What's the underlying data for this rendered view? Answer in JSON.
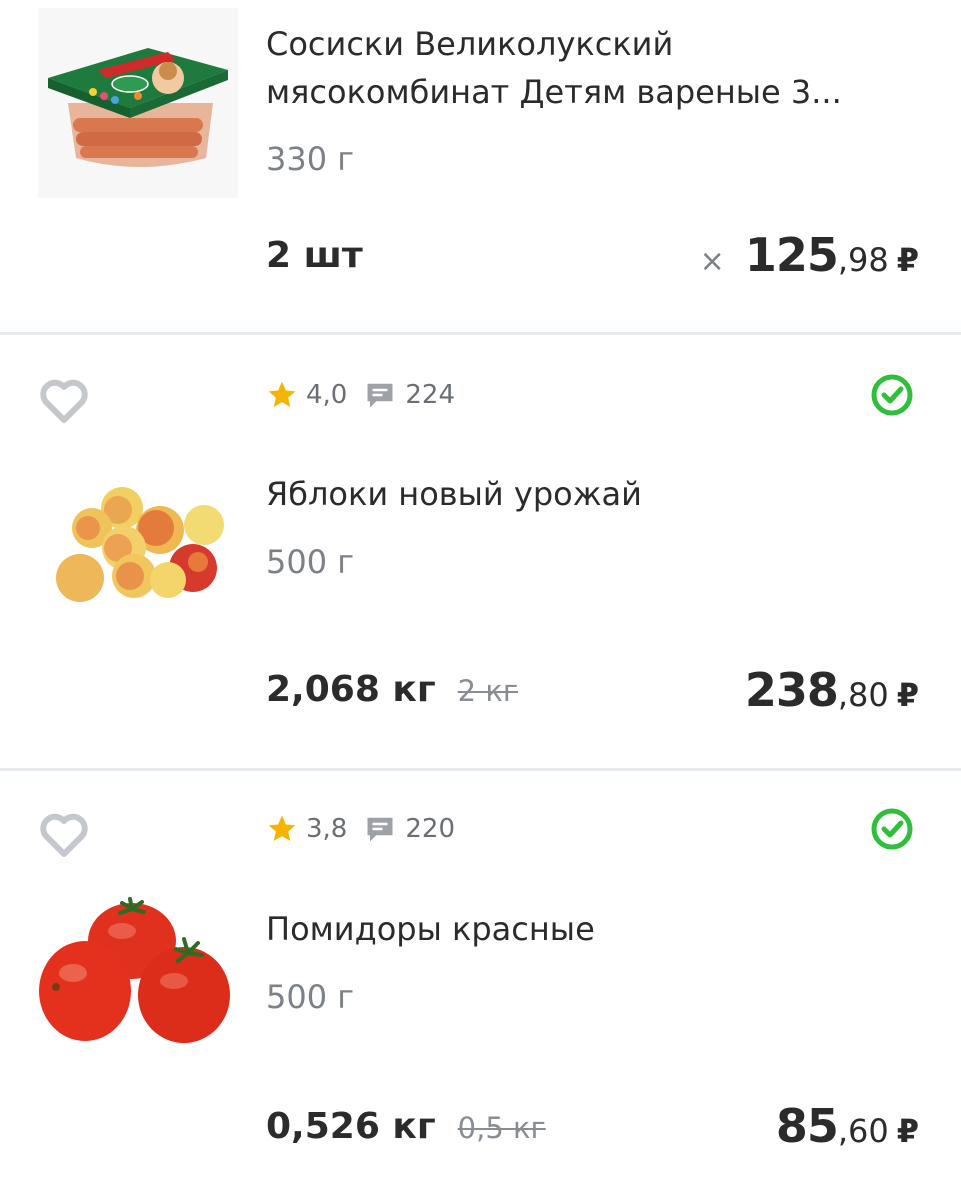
{
  "items": [
    {
      "title_line1": "Сосиски Великолукский",
      "title_line2": "мясокомбинат Детям вареные 3...",
      "weight": "330 г",
      "quantity": "2 шт",
      "multiplier": "×",
      "price_int": "125",
      "price_frac": ",98",
      "currency": "₽",
      "image": "sausage-package-icon"
    },
    {
      "rating": "4,0",
      "reviews": "224",
      "title": "Яблоки новый урожай",
      "weight": "500 г",
      "quantity": "2,068 кг",
      "old_quantity": "2 кг",
      "price_int": "238",
      "price_frac": ",80",
      "currency": "₽",
      "image": "apples-icon"
    },
    {
      "rating": "3,8",
      "reviews": "220",
      "title": "Помидоры красные",
      "weight": "500 г",
      "quantity": "0,526 кг",
      "old_quantity": "0,5 кг",
      "price_int": "85",
      "price_frac": ",60",
      "currency": "₽",
      "image": "tomatoes-icon"
    }
  ],
  "colors": {
    "star": "#f5b400",
    "check": "#2fbf3a",
    "divider": "#e6e9ee",
    "heart": "#c4c7cc"
  }
}
